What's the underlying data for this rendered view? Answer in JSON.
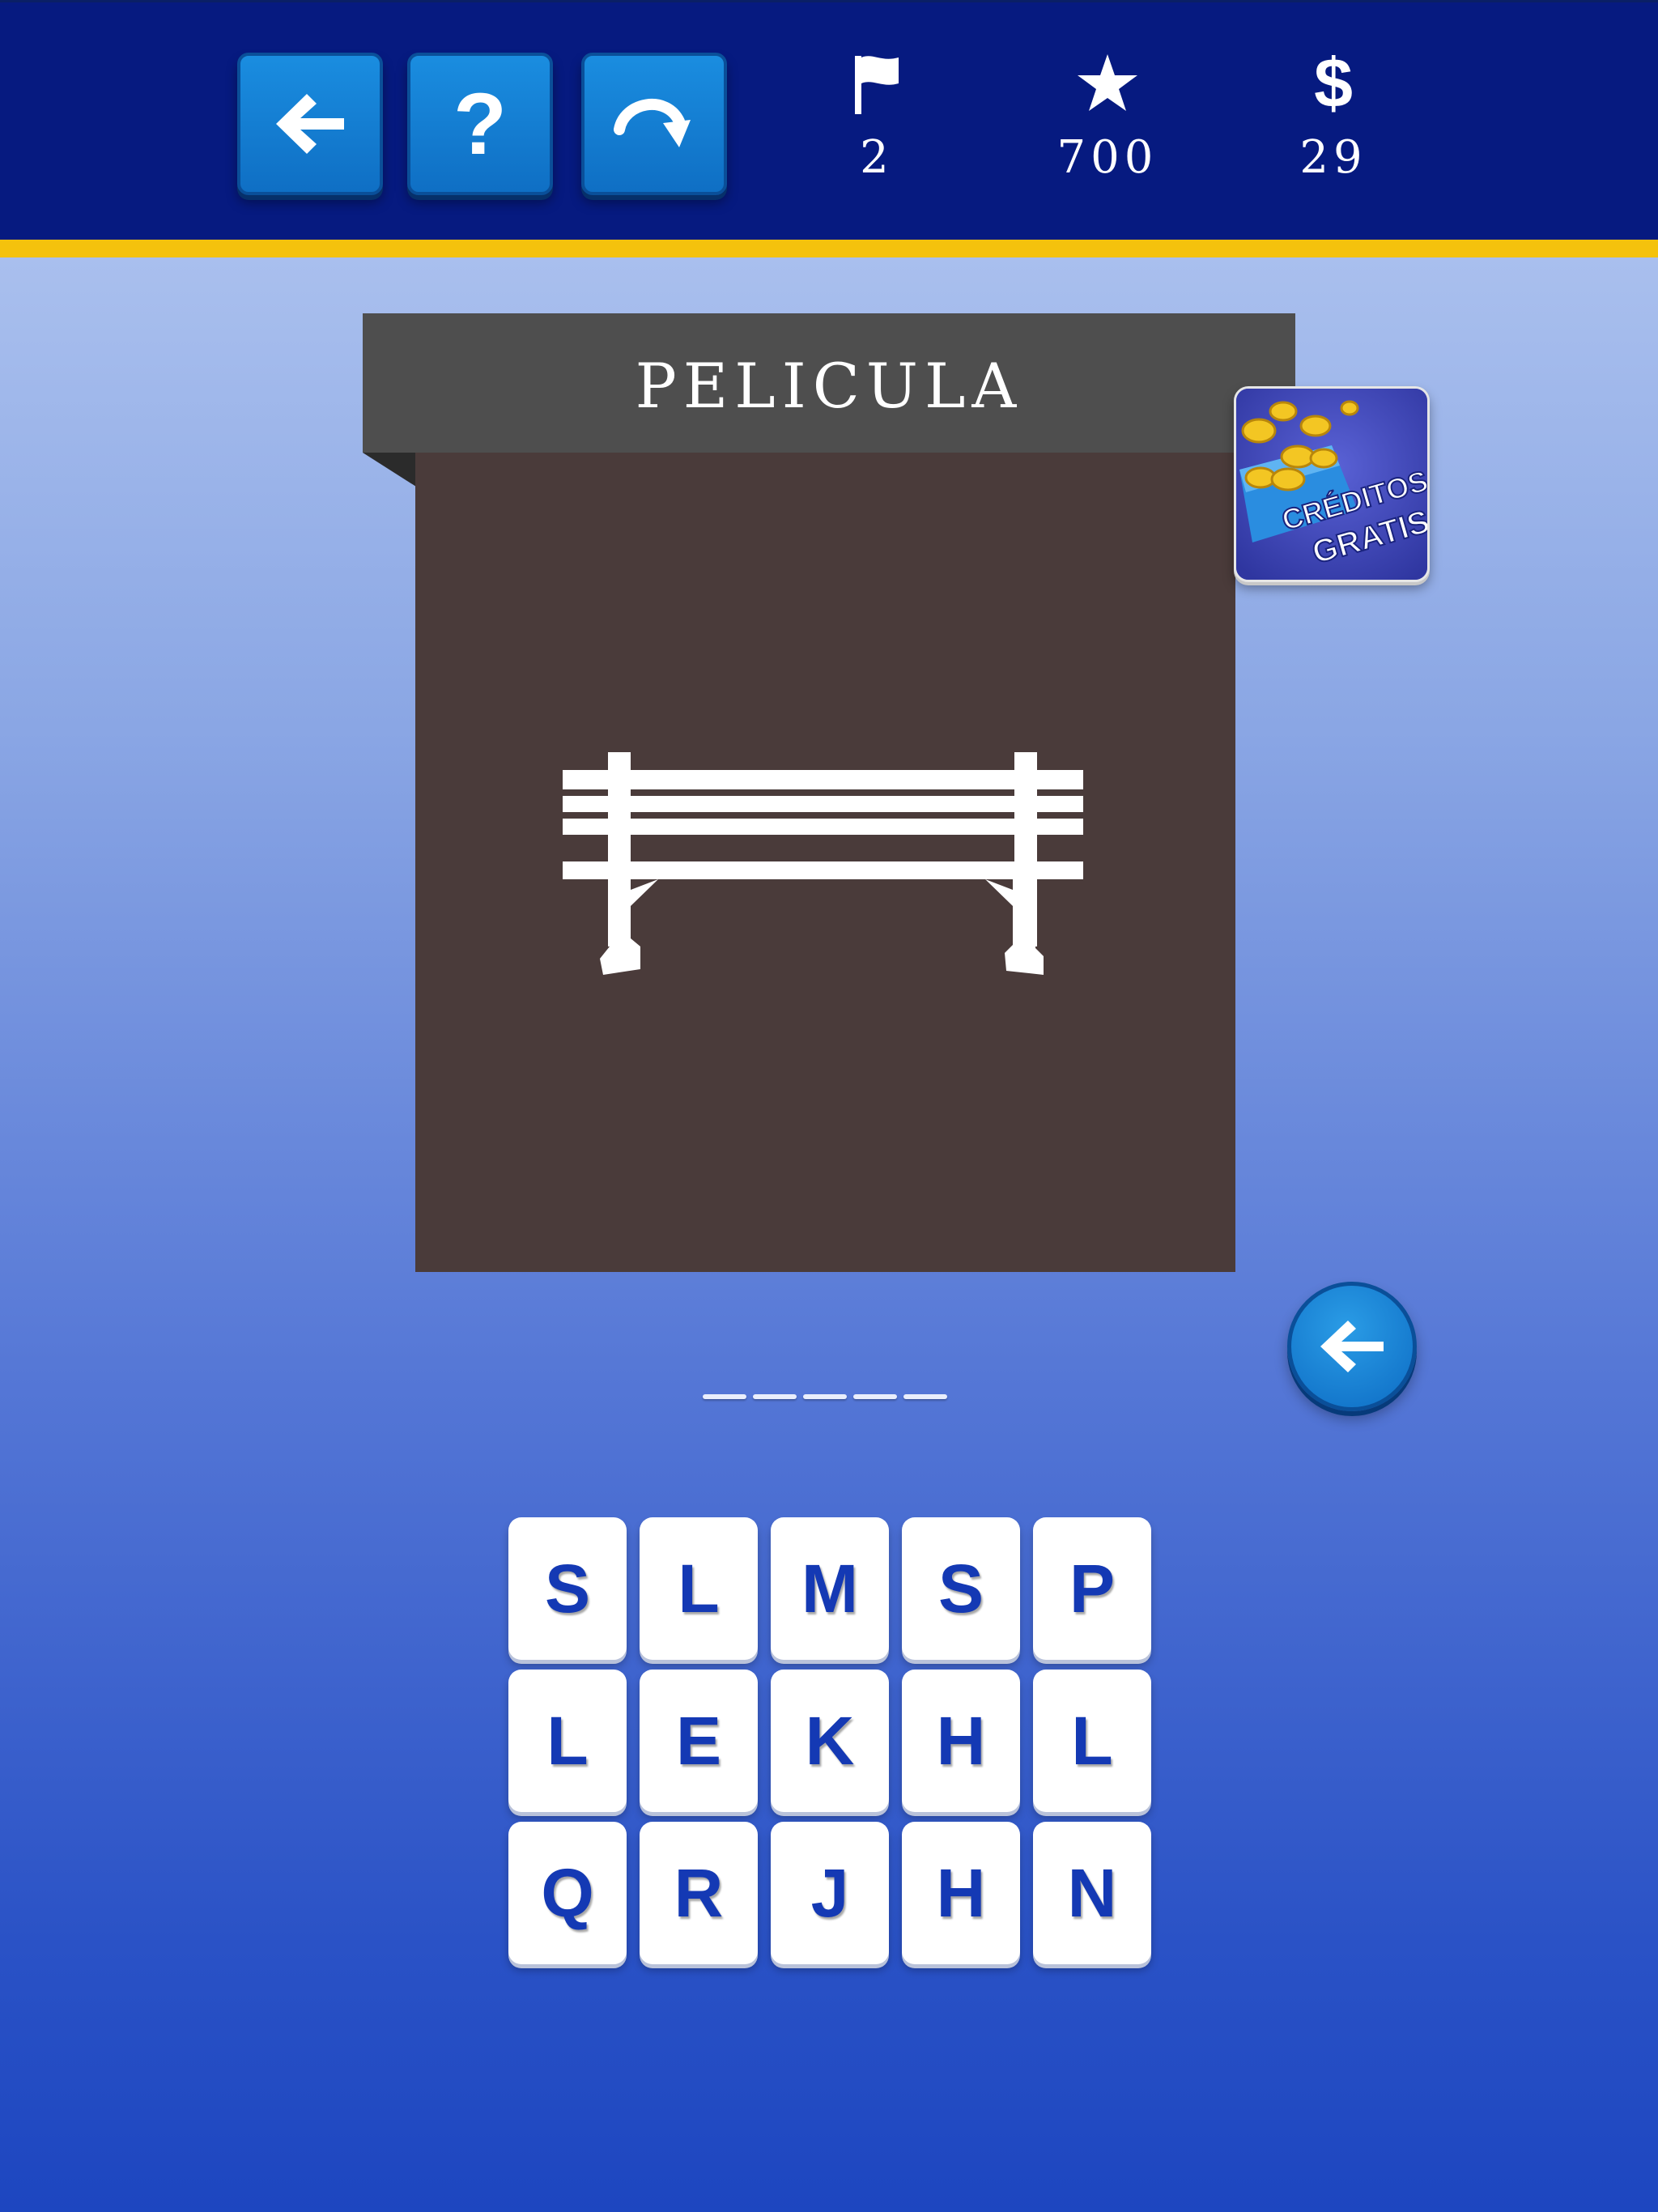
{
  "colors": {
    "topbar": "#061a80",
    "accent_stripe": "#f4c20d",
    "button_blue": "#1580d4",
    "tile_text": "#1439b4",
    "banner": "#4e4e4e",
    "image_bg": "#4a3b3a"
  },
  "toolbar": {
    "back_icon": "arrow-left-icon",
    "help_label": "?",
    "skip_icon": "curved-arrow-icon"
  },
  "stats": {
    "level": "2",
    "score": "700",
    "coins": "29"
  },
  "puzzle": {
    "category": "PELICULA",
    "image_icon": "park-bench-icon",
    "answer_length": 5
  },
  "promo": {
    "line1": "CRÉDITOS",
    "line2": "GRATIS"
  },
  "letters": [
    "S",
    "L",
    "M",
    "S",
    "P",
    "L",
    "E",
    "K",
    "H",
    "L",
    "Q",
    "R",
    "J",
    "H",
    "N"
  ]
}
